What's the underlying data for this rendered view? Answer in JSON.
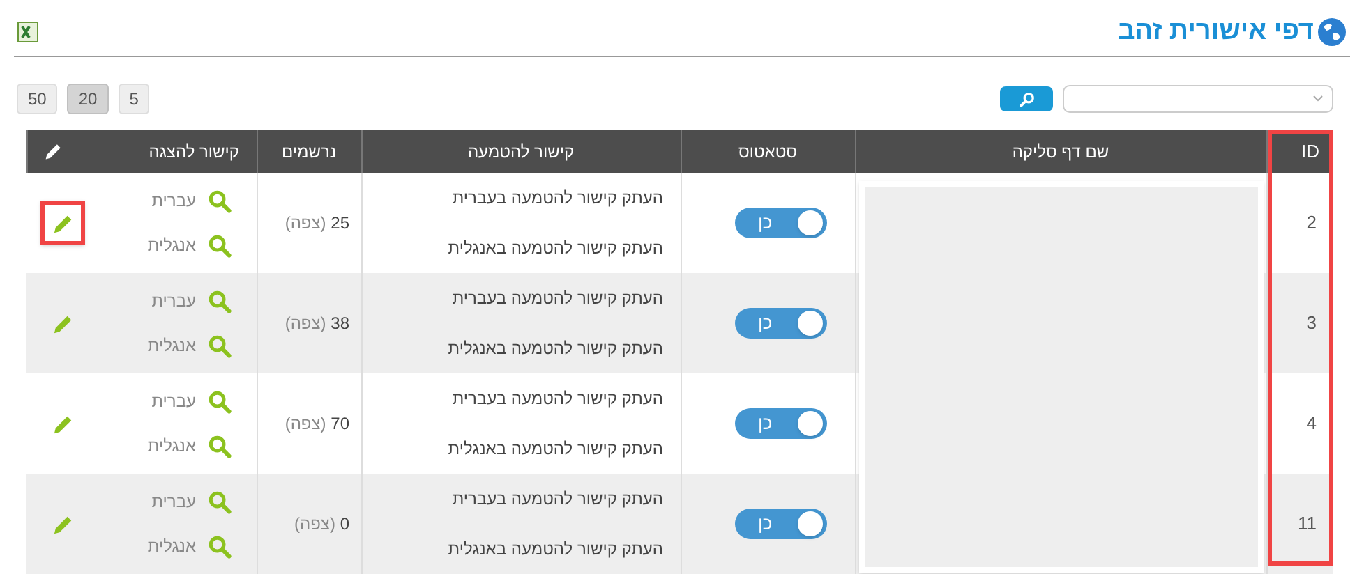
{
  "title": "דפי אישורית זהב",
  "page_sizes": [
    {
      "label": "5",
      "selected": false
    },
    {
      "label": "20",
      "selected": true
    },
    {
      "label": "50",
      "selected": false
    }
  ],
  "columns": [
    {
      "label": "ID",
      "highlighted": true
    },
    {
      "label": "שם דף סליקה",
      "highlighted": false
    },
    {
      "label": "סטאטוס",
      "highlighted": false
    },
    {
      "label": "קישור להטמעה",
      "highlighted": false
    },
    {
      "label": "נרשמים",
      "highlighted": false
    },
    {
      "label": "קישור להצגה",
      "highlighted": false
    }
  ],
  "rows": [
    {
      "id": "2",
      "status": {
        "on": true,
        "label": "כן"
      },
      "embed_links": [
        "העתק קישור להטמעה בעברית",
        "העתק קישור להטמעה באנגלית"
      ],
      "registered": "25",
      "view": "(צפה)",
      "display_links": [
        "עברית",
        "אנגלית"
      ],
      "edit_highlighted": true
    },
    {
      "id": "3",
      "status": {
        "on": true,
        "label": "כן"
      },
      "embed_links": [
        "העתק קישור להטמעה בעברית",
        "העתק קישור להטמעה באנגלית"
      ],
      "registered": "38",
      "view": "(צפה)",
      "display_links": [
        "עברית",
        "אנגלית"
      ],
      "edit_highlighted": false
    },
    {
      "id": "4",
      "status": {
        "on": true,
        "label": "כן"
      },
      "embed_links": [
        "העתק קישור להטמעה בעברית",
        "העתק קישור להטמעה באנגלית"
      ],
      "registered": "70",
      "view": "(צפה)",
      "display_links": [
        "עברית",
        "אנגלית"
      ],
      "edit_highlighted": false
    },
    {
      "id": "11",
      "status": {
        "on": true,
        "label": "כן"
      },
      "embed_links": [
        "העתק קישור להטמעה בעברית",
        "העתק קישור להטמעה באנגלית"
      ],
      "registered": "0",
      "view": "(צפה)",
      "display_links": [
        "עברית",
        "אנגלית"
      ],
      "edit_highlighted": false
    }
  ]
}
